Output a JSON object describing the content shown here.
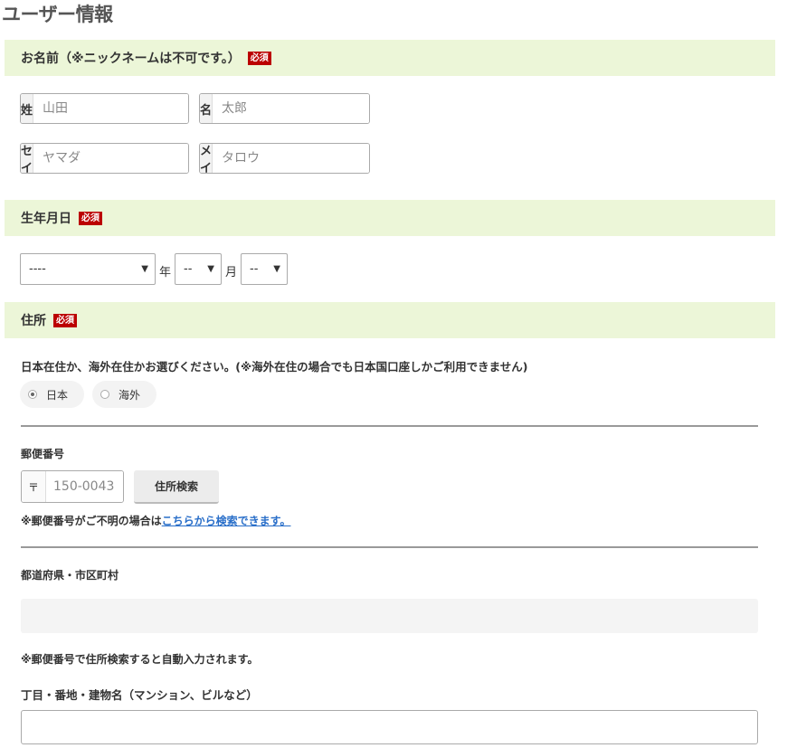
{
  "page": {
    "title": "ユーザー情報"
  },
  "required_badge": "必須",
  "name_section": {
    "heading": "お名前（※ニックネームは不可です。）",
    "fields": [
      {
        "prefix": "姓",
        "placeholder": "山田"
      },
      {
        "prefix": "名",
        "placeholder": "太郎"
      },
      {
        "prefix": "セイ",
        "placeholder": "ヤマダ"
      },
      {
        "prefix": "メイ",
        "placeholder": "タロウ"
      }
    ]
  },
  "birth_section": {
    "heading": "生年月日",
    "year": {
      "value": "----",
      "unit": "年"
    },
    "month": {
      "value": "--",
      "unit": "月"
    },
    "day": {
      "value": "--"
    }
  },
  "address_section": {
    "heading": "住所",
    "residence_question": "日本在住か、海外在住かお選びください。(※海外在住の場合でも日本国口座しかご利用できません)",
    "residence_options": [
      {
        "label": "日本",
        "checked": true
      },
      {
        "label": "海外",
        "checked": false
      }
    ],
    "postal": {
      "label": "郵便番号",
      "prefix": "〒",
      "placeholder": "150-0043",
      "search_button": "住所検索",
      "help_prefix": "※郵便番号がご不明の場合は",
      "help_link": "こちらから検索できます。"
    },
    "prefecture_city": {
      "label": "都道府県・市区町村",
      "value": "",
      "note": "※郵便番号で住所検索すると自動入力されます。"
    },
    "street": {
      "label": "丁目・番地・建物名（マンション、ビルなど）",
      "value": ""
    }
  },
  "colors": {
    "section_bg": "#ecf6d8",
    "required_badge": "#bb0000",
    "link": "#2a6fc9"
  }
}
